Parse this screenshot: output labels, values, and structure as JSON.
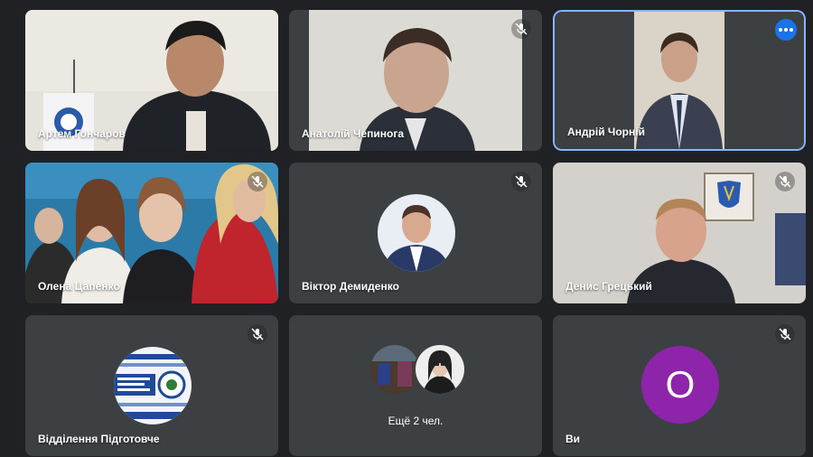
{
  "participants": [
    {
      "name": "Артем Гончаров",
      "muted": false
    },
    {
      "name": "Анатолій Чепинога",
      "muted": true
    },
    {
      "name": "Андрій Чорній",
      "muted": false,
      "active": true
    },
    {
      "name": "Олена Цапенко",
      "muted": true
    },
    {
      "name": "Віктор Демиденко",
      "muted": true
    },
    {
      "name": "Денис Грецький",
      "muted": true
    },
    {
      "name": "Відділення Підготовче",
      "muted": true
    },
    {
      "name": "Ви",
      "muted": true,
      "initial": "О"
    }
  ],
  "overflow": {
    "label": "Ещё 2 чел."
  },
  "colors": {
    "background": "#202124",
    "tile": "#3c4043",
    "active_border": "#8ab4f8",
    "self_avatar": "#8e24aa",
    "options_button": "#1a73e8"
  },
  "icons": {
    "mute": "mic-off-icon",
    "options": "more-horiz-icon"
  }
}
